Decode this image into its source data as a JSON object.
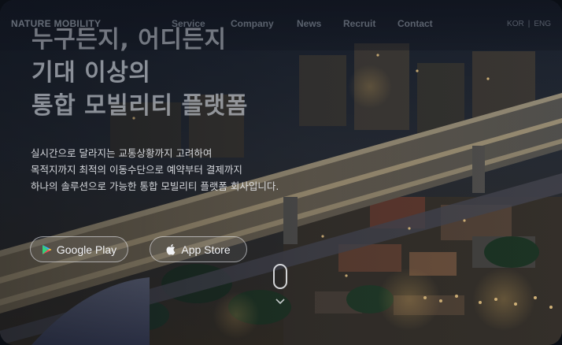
{
  "header": {
    "logo": "NATURE MOBILITY",
    "nav": [
      {
        "label": "Service"
      },
      {
        "label": "Company"
      },
      {
        "label": "News"
      },
      {
        "label": "Recruit"
      },
      {
        "label": "Contact"
      }
    ],
    "lang": {
      "kor": "KOR",
      "sep": "|",
      "eng": "ENG"
    }
  },
  "hero": {
    "headline": [
      "누구든지, 어디든지",
      "기대 이상의",
      "통합 모빌리티 플랫폼"
    ],
    "description": [
      "실시간으로 달라지는 교통상황까지 고려하여",
      "목적지까지 최적의 이동수단으로 예약부터 결제까지",
      "하나의 솔루션으로 가능한 통합 모빌리티 플랫폼 회사입니다."
    ],
    "buttons": {
      "google_play": {
        "label": "Google Play",
        "icon": "google-play-icon"
      },
      "app_store": {
        "label": "App Store",
        "icon": "apple-icon"
      }
    },
    "scroll_indicator": {
      "icon": "mouse-scroll-icon"
    }
  },
  "colors": {
    "overlay": "#0a0e16",
    "headline": "#d2d6de",
    "button_border": "#e6e8ee",
    "city_lights": "#f3b04a"
  }
}
